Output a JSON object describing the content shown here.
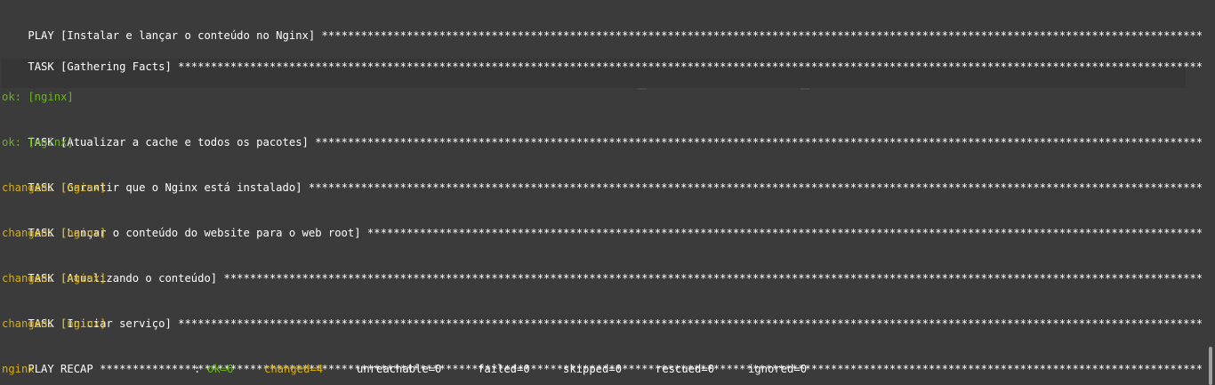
{
  "play": {
    "header": "PLAY [Instalar e lançar o conteúdo no Nginx]"
  },
  "tasks": [
    {
      "header": "TASK [Gathering Facts]",
      "status": "ok: [nginx]"
    },
    {
      "header": "TASK [Atualizar a cache e todos os pacotes]",
      "status": "ok: [nginx]"
    },
    {
      "header": "TASK [Garantir que o Nginx está instalado]",
      "status": "changed: [nginx]"
    },
    {
      "header": "TASK [Lançar o conteúdo do website para o web root]",
      "status": "changed: [nginx]"
    },
    {
      "header": "TASK [Atualizando o conteúdo]",
      "status": "changed: [nginx]"
    },
    {
      "header": "TASK [Iniciar serviço]",
      "status": "changed: [nginx]"
    }
  ],
  "recap": {
    "header": "PLAY RECAP",
    "host": "nginx",
    "separator": ":",
    "ok": "ok=6",
    "changed": "changed=4",
    "unreachable": "unreachable=0",
    "failed": "failed=0",
    "skipped": "skipped=0",
    "rescued": "rescued=0",
    "ignored": "ignored=0"
  },
  "colors": {
    "background": "#3b3b3b",
    "text": "#ffffff",
    "ok": "#6bb324",
    "changed": "#d7ad0e"
  }
}
